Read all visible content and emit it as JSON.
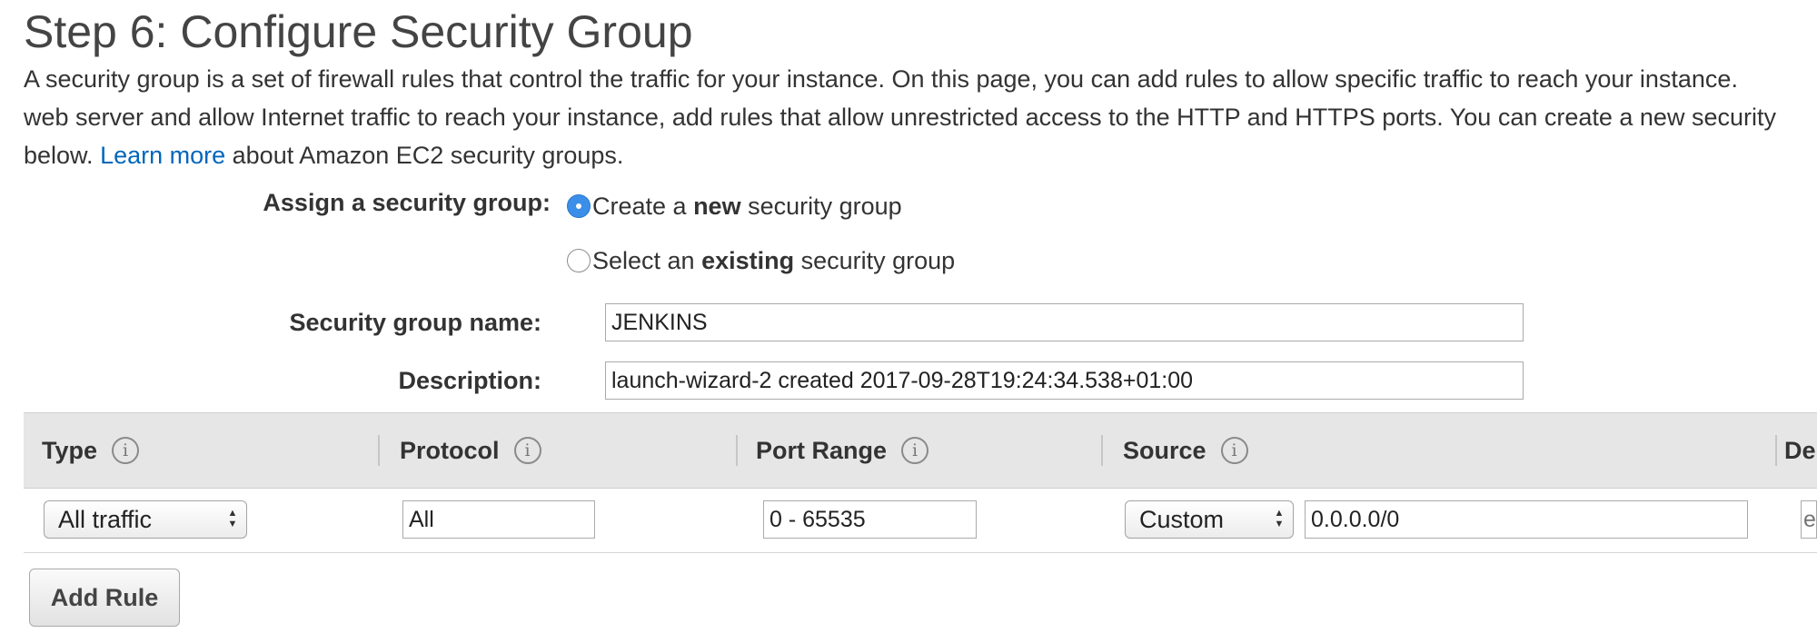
{
  "page": {
    "title": "Step 6: Configure Security Group",
    "intro_line1": "A security group is a set of firewall rules that control the traffic for your instance. On this page, you can add rules to allow specific traffic to reach your instance.",
    "intro_line2": "web server and allow Internet traffic to reach your instance, add rules that allow unrestricted access to the HTTP and HTTPS ports. You can create a new security",
    "intro_line3_prefix": "below. ",
    "learn_more": "Learn more",
    "intro_line3_suffix": " about Amazon EC2 security groups."
  },
  "assign": {
    "label": "Assign a security group:",
    "option_create": {
      "prefix": "Create a ",
      "bold": "new",
      "suffix": " security group",
      "selected": true
    },
    "option_existing": {
      "prefix": "Select an ",
      "bold": "existing",
      "suffix": " security group",
      "selected": false
    }
  },
  "form": {
    "name_label": "Security group name:",
    "name_value": "JENKINS",
    "description_label": "Description:",
    "description_value": "launch-wizard-2 created 2017-09-28T19:24:34.538+01:00"
  },
  "table": {
    "columns": [
      "Type",
      "Protocol",
      "Port Range",
      "Source",
      "De"
    ],
    "rows": [
      {
        "type": "All traffic",
        "protocol": "All",
        "port_range": "0 - 65535",
        "source_type": "Custom",
        "source_value": "0.0.0.0/0",
        "description": "e.g. SSH for Admin Desktop"
      }
    ]
  },
  "actions": {
    "add_rule": "Add Rule"
  },
  "colors": {
    "accent": "#3b8fe8",
    "link": "#0066bb",
    "header_bg": "#e6e6e6"
  },
  "icons": {
    "info": "info-icon",
    "select_arrows": "updown-arrows-icon",
    "radio_on": "radio-selected",
    "radio_off": "radio-unselected"
  }
}
